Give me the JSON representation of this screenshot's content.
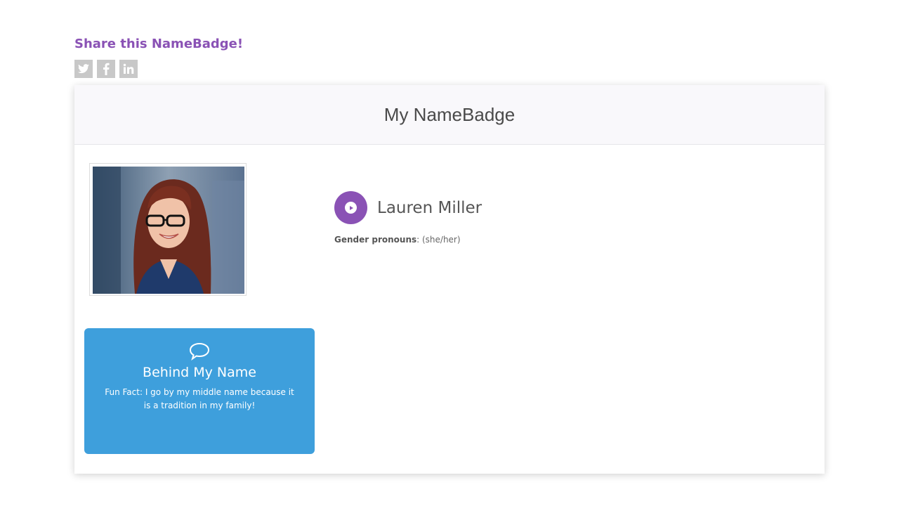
{
  "share": {
    "title": "Share this NameBadge!",
    "buttons": [
      {
        "name": "twitter",
        "icon": "twitter-icon"
      },
      {
        "name": "facebook",
        "icon": "facebook-icon"
      },
      {
        "name": "linkedin",
        "icon": "linkedin-icon"
      }
    ]
  },
  "badge": {
    "title": "My NameBadge",
    "person": {
      "name": "Lauren Miller",
      "pronouns_label": "Gender pronouns",
      "pronouns_value": ": (she/her)"
    },
    "behind": {
      "icon": "speech-bubble-icon",
      "title": "Behind My Name",
      "text": "Fun Fact: I go by my middle name because it is a tradition in my family!"
    }
  },
  "colors": {
    "accent_purple": "#8a52b5",
    "card_blue": "#3e9fdc",
    "social_gray": "#c8c8c8"
  }
}
